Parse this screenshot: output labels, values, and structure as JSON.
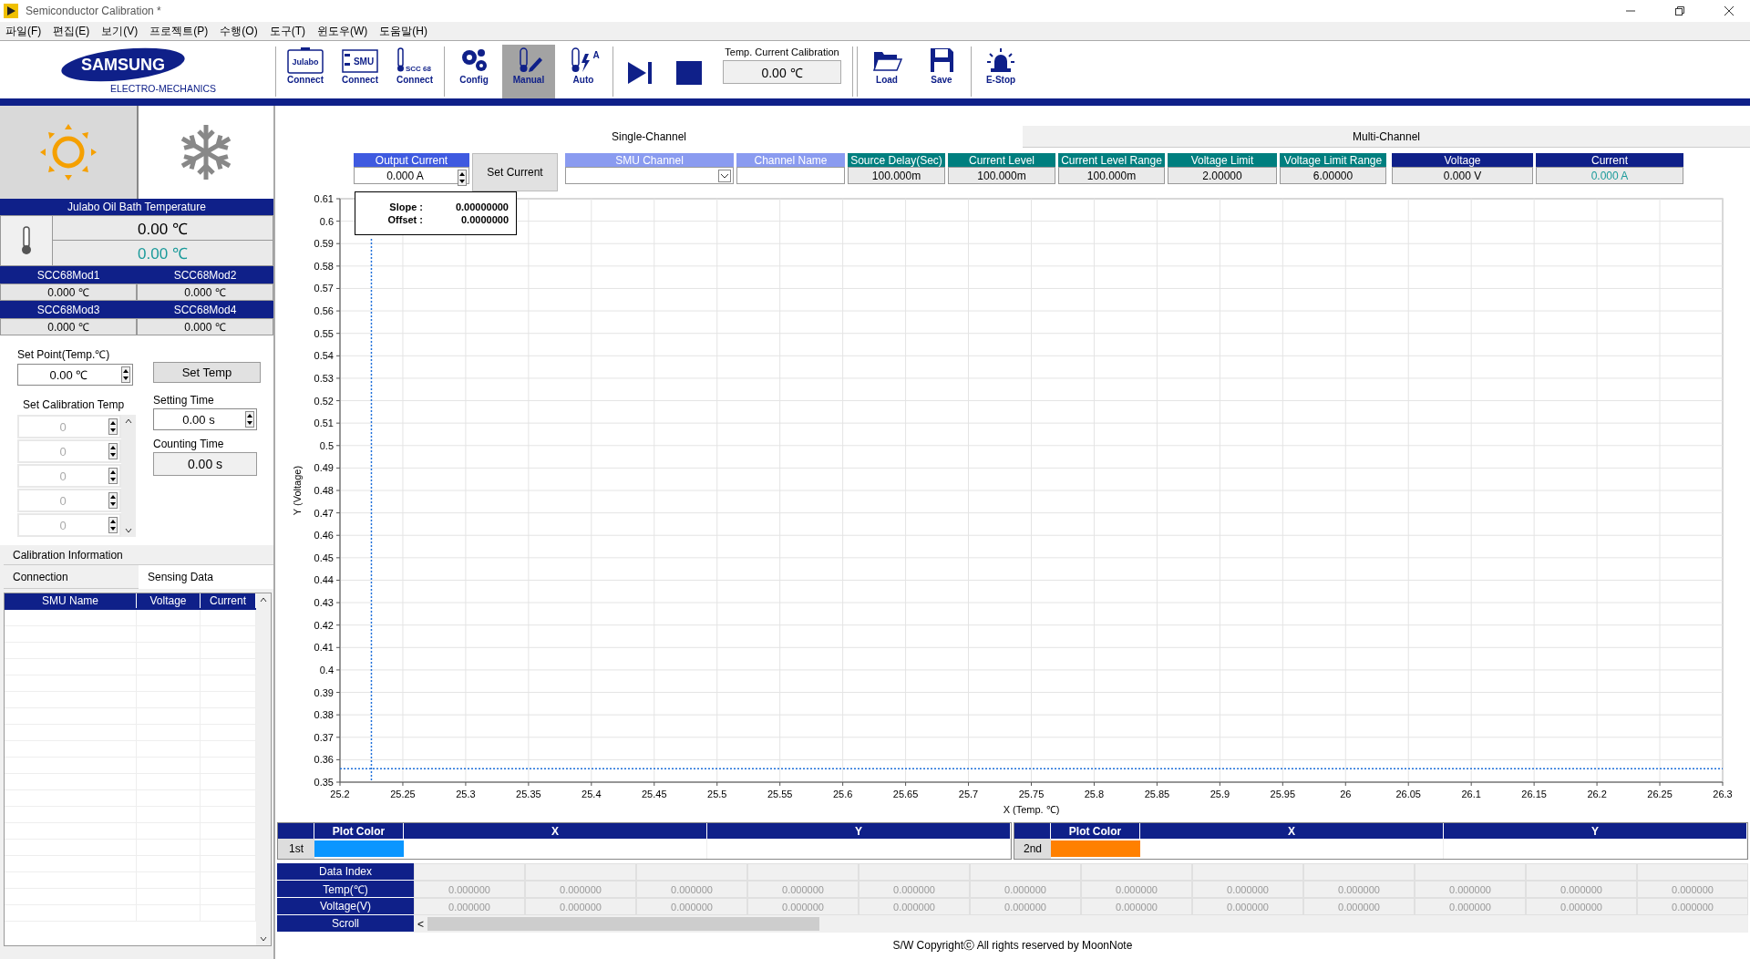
{
  "window": {
    "title": "Semiconductor Calibration *"
  },
  "menu": [
    "파일(F)",
    "편집(E)",
    "보기(V)",
    "프로젝트(P)",
    "수행(O)",
    "도구(T)",
    "윈도우(W)",
    "도움말(H)"
  ],
  "logo": {
    "brand": "SAMSUNG",
    "subtitle": "ELECTRO-MECHANICS"
  },
  "toolbar": [
    {
      "kind": "julabo",
      "label": "Connect",
      "icon_text": "Julabo",
      "selected": false
    },
    {
      "kind": "smu",
      "label": "Connect",
      "icon_text": "SMU",
      "selected": false
    },
    {
      "kind": "scc",
      "label": "Connect",
      "icon_text": "SCC 68",
      "selected": false
    },
    {
      "kind": "config",
      "label": "Config",
      "selected": false
    },
    {
      "kind": "manual",
      "label": "Manual",
      "selected": true
    },
    {
      "kind": "auto",
      "label": "Auto",
      "icon_text": "A",
      "selected": false
    },
    {
      "kind": "run",
      "selected": false
    },
    {
      "kind": "stop",
      "selected": false
    },
    {
      "kind": "readout",
      "label": "Temp. Current Calibration",
      "value": "0.00 ℃"
    },
    {
      "kind": "load",
      "label": "Load",
      "selected": false
    },
    {
      "kind": "save",
      "label": "Save",
      "selected": false
    },
    {
      "kind": "estop",
      "label": "E-Stop",
      "selected": false
    }
  ],
  "left": {
    "modes": [
      {
        "kind": "heat",
        "selected": true
      },
      {
        "kind": "cool",
        "selected": false
      }
    ],
    "julabo": {
      "title": "Julabo Oil Bath Temperature",
      "readings": [
        {
          "value": "0.00 ℃",
          "color": "#000000"
        },
        {
          "value": "0.00 ℃",
          "color": "#1a9a9a"
        }
      ]
    },
    "modules": [
      {
        "name": "SCC68Mod1",
        "value": "0.000 ℃"
      },
      {
        "name": "SCC68Mod2",
        "value": "0.000 ℃"
      },
      {
        "name": "SCC68Mod3",
        "value": "0.000 ℃"
      },
      {
        "name": "SCC68Mod4",
        "value": "0.000 ℃"
      }
    ],
    "set_point": {
      "label": "Set Point(Temp.℃)",
      "value": "0.00 ℃",
      "button": "Set Temp"
    },
    "calibration_temps": {
      "label": "Set Calibration Temp",
      "disabled": true,
      "values": [
        "0",
        "0",
        "0",
        "0",
        "0"
      ]
    },
    "setting_time": {
      "label": "Setting Time",
      "value": "0.00 s"
    },
    "counting_time": {
      "label": "Counting Time",
      "value": "0.00 s"
    },
    "tab_rows": [
      [
        {
          "label": "Calibration Information",
          "selected": false
        }
      ],
      [
        {
          "label": "Connection",
          "selected": false
        },
        {
          "label": "Sensing Data",
          "selected": true
        }
      ]
    ],
    "smu_table": {
      "columns": [
        "SMU Name",
        "Voltage",
        "Current"
      ]
    }
  },
  "tabs": [
    {
      "label": "Single-Channel",
      "selected": true
    },
    {
      "label": "Multi-Channel",
      "selected": false
    }
  ],
  "controls": [
    {
      "kind": "numeric",
      "label": "Output Current",
      "value": "0.000 A"
    },
    {
      "kind": "button",
      "label": "Set Current"
    },
    {
      "kind": "dropdown",
      "label": "SMU Channel"
    },
    {
      "kind": "text",
      "label": "Channel Name"
    },
    {
      "kind": "setting",
      "label": "Source Delay(Sec)",
      "value": "100.000m"
    },
    {
      "kind": "setting",
      "label": "Current Level",
      "value": "100.000m"
    },
    {
      "kind": "setting",
      "label": "Current Level Range",
      "value": "100.000m"
    },
    {
      "kind": "setting",
      "label": "Voltage Limit",
      "value": "2.00000"
    },
    {
      "kind": "setting",
      "label": "Voltage Limit Range",
      "value": "6.00000"
    },
    {
      "kind": "indicator",
      "label": "Voltage",
      "value": "0.000 V",
      "color": "#000000"
    },
    {
      "kind": "indicator",
      "label": "Current",
      "value": "0.000 A",
      "color": "#1a9a9a"
    }
  ],
  "fit": [
    {
      "label": "Slope :",
      "value": "0.00000000"
    },
    {
      "label": "Offset :",
      "value": "0.0000000"
    }
  ],
  "chart_data": {
    "type": "scatter",
    "xlabel": "X (Temp. ℃)",
    "ylabel": "Y (Voltage)",
    "xlim": [
      25.2,
      26.3
    ],
    "ylim": [
      0.35,
      0.61
    ],
    "xticks": [
      25.2,
      25.25,
      25.3,
      25.35,
      25.4,
      25.45,
      25.5,
      25.55,
      25.6,
      25.65,
      25.7,
      25.75,
      25.8,
      25.85,
      25.9,
      25.95,
      26,
      26.05,
      26.1,
      26.15,
      26.2,
      26.25,
      26.3
    ],
    "yticks": [
      0.35,
      0.36,
      0.37,
      0.38,
      0.39,
      0.4,
      0.41,
      0.42,
      0.43,
      0.44,
      0.45,
      0.46,
      0.47,
      0.48,
      0.49,
      0.5,
      0.51,
      0.52,
      0.53,
      0.54,
      0.55,
      0.56,
      0.57,
      0.58,
      0.59,
      0.6,
      0.61
    ],
    "grid": true,
    "ref_lines": [
      {
        "axis": "x",
        "value": 25.225
      },
      {
        "axis": "y",
        "value": 0.356
      }
    ]
  },
  "plots": [
    {
      "name": "1st",
      "color": "#0a96ff",
      "columns": [
        "Plot Color",
        "X",
        "Y"
      ]
    },
    {
      "name": "2nd",
      "color": "#ff8000",
      "columns": [
        "Plot Color",
        "X",
        "Y"
      ]
    }
  ],
  "data_table": {
    "rows": [
      {
        "kind": "values",
        "label": "Data Index",
        "cells": []
      },
      {
        "kind": "values",
        "label": "Temp(℃)",
        "cells": [
          "0.000000",
          "0.000000",
          "0.000000",
          "0.000000",
          "0.000000",
          "0.000000",
          "0.000000",
          "0.000000",
          "0.000000",
          "0.000000",
          "0.000000",
          "0.000000"
        ]
      },
      {
        "kind": "values",
        "label": "Voltage(V)",
        "cells": [
          "0.000000",
          "0.000000",
          "0.000000",
          "0.000000",
          "0.000000",
          "0.000000",
          "0.000000",
          "0.000000",
          "0.000000",
          "0.000000",
          "0.000000",
          "0.000000"
        ]
      },
      {
        "kind": "scroll",
        "label": "Scroll",
        "arrow": "<"
      }
    ]
  },
  "footer": "S/W Copyrightⓒ All rights reserved by MoonNote"
}
